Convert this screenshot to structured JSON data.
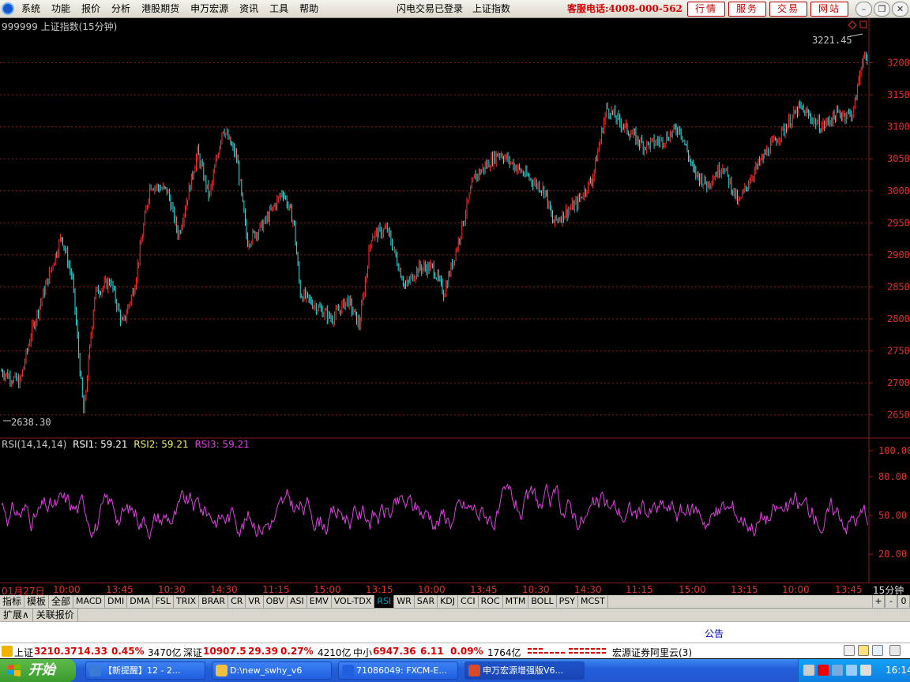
{
  "menu": {
    "items": [
      "系统",
      "功能",
      "报价",
      "分析",
      "港股期货",
      "申万宏源",
      "资讯",
      "工具",
      "帮助"
    ],
    "login_status": "闪电交易已登录",
    "current_index": "上证指数",
    "hotline": "客服电话:4008-000-562",
    "top_buttons": [
      "行情",
      "服务",
      "交易",
      "网站"
    ]
  },
  "chart": {
    "title": "999999 上证指数(15分钟)",
    "high_label": "3221.45",
    "low_label": "2638.30",
    "price_ticks": [
      "3200",
      "3150",
      "3100",
      "3050",
      "3000",
      "2950",
      "2900",
      "2850",
      "2800",
      "2750",
      "2700",
      "2650"
    ],
    "rsi_ticks": [
      "100.00",
      "80.00",
      "50.00",
      "20.00"
    ],
    "rsi_label": "RSI(14,14,14)",
    "rsi1": "RSI1: 59.21",
    "rsi2": "RSI2: 59.21",
    "rsi3": "RSI3: 59.21",
    "colors": {
      "up": "#ff3030",
      "down": "#30e0e0",
      "rsi": "#e040e0",
      "grid": "#8a1a1a"
    }
  },
  "time_axis": {
    "labels": [
      "01月27日",
      "10:00",
      "13:45",
      "10:30",
      "14:30",
      "11:15",
      "15:00",
      "13:15",
      "10:00",
      "13:45",
      "10:30",
      "14:30",
      "11:15",
      "15:00",
      "13:15",
      "10:00",
      "13:45"
    ],
    "period": "15分钟"
  },
  "indicator_tabs": [
    "指标",
    "模板",
    "全部",
    "MACD",
    "DMI",
    "DMA",
    "FSL",
    "TRIX",
    "BRAR",
    "CR",
    "VR",
    "OBV",
    "ASI",
    "EMV",
    "VOL-TDX",
    "RSI",
    "WR",
    "SAR",
    "KDJ",
    "CCI",
    "ROC",
    "MTM",
    "BOLL",
    "PSY",
    "MCST"
  ],
  "active_indicator": "RSI",
  "tab_controls": [
    "+",
    "-",
    "0"
  ],
  "bottom_tabs": [
    "扩展∧",
    "关联报价"
  ],
  "notice": "公告",
  "ticker": {
    "sh_name": "上证",
    "sh_price": "3210.37",
    "sh_change": "14.33",
    "sh_pct": "0.45%",
    "sh_vol": "3470亿",
    "sz_name": "深证",
    "sz_price": "10907.5",
    "sz_change": "29.39",
    "sz_pct": "0.27%",
    "sz_vol": "4210亿",
    "zx_name": "中小",
    "zx_price": "6947.36",
    "zx_change": "6.11",
    "zx_pct": "0.09%",
    "zx_vol": "1764亿",
    "server": "宏源证券阿里云(3)"
  },
  "taskbar": {
    "start": "开始",
    "tasks": [
      "【新提醒】12 - 2...",
      "D:\\new_swhy_v6",
      "71086049: FXCM-E...",
      "申万宏源增强版V6..."
    ],
    "clock": "16:14"
  }
}
